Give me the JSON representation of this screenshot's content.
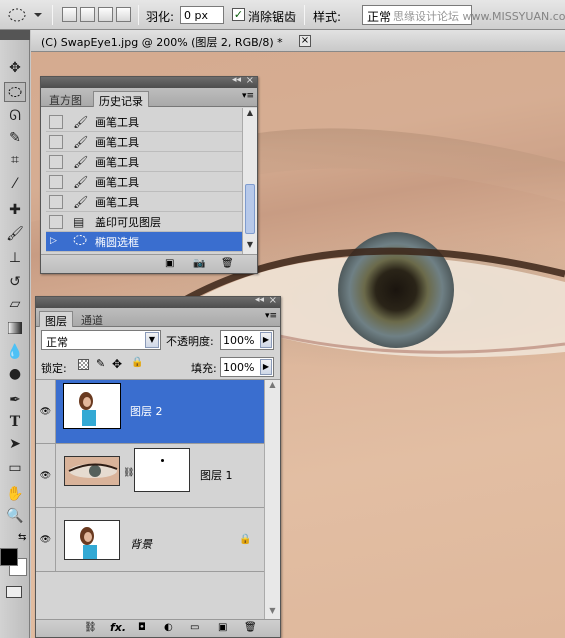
{
  "options_bar": {
    "feather_label": "羽化:",
    "feather_value": "0 px",
    "antialias_label": "消除锯齿",
    "style_label": "样式:",
    "style_value": "正常",
    "watermark": "思缘设计论坛 www.MISSYUAN.com"
  },
  "document": {
    "tab_title": "(C) SwapEye1.jpg @ 200% (图层 2, RGB/8) *"
  },
  "history_panel": {
    "tabs": [
      "直方图",
      "历史记录"
    ],
    "active_tab": "历史记录",
    "items": [
      {
        "label": "画笔工具",
        "icon": "brush-icon"
      },
      {
        "label": "画笔工具",
        "icon": "brush-icon"
      },
      {
        "label": "画笔工具",
        "icon": "brush-icon"
      },
      {
        "label": "画笔工具",
        "icon": "brush-icon"
      },
      {
        "label": "画笔工具",
        "icon": "brush-icon"
      },
      {
        "label": "盖印可见图层",
        "icon": "stamp-visible-icon"
      },
      {
        "label": "椭圆选框",
        "icon": "elliptical-marquee-icon",
        "selected": true
      }
    ]
  },
  "layers_panel": {
    "tabs": [
      "图层",
      "通道"
    ],
    "active_tab": "图层",
    "blend_mode": "正常",
    "opacity_label": "不透明度:",
    "opacity_value": "100%",
    "lock_label": "锁定:",
    "fill_label": "填充:",
    "fill_value": "100%",
    "layers": [
      {
        "name": "图层 2",
        "selected": true,
        "visible": true
      },
      {
        "name": "图层 1",
        "selected": false,
        "visible": true,
        "has_mask": true
      },
      {
        "name": "背景",
        "selected": false,
        "visible": true,
        "locked": true
      }
    ]
  },
  "colors": {
    "selection": "#3a6ecf",
    "panel_bg": "#d4d4d4"
  }
}
